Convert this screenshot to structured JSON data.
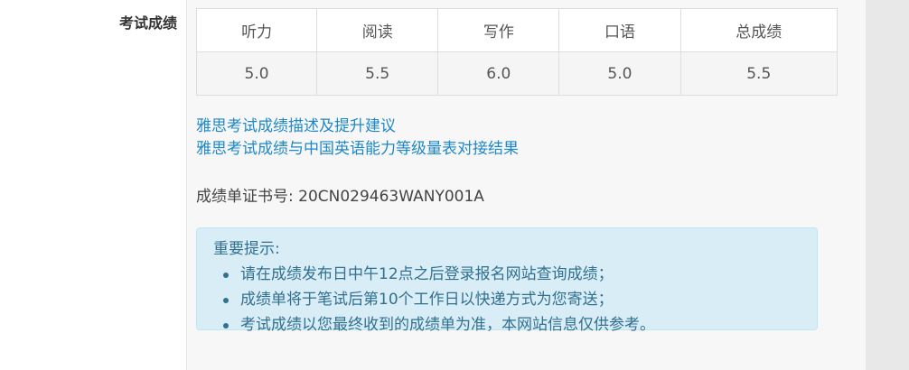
{
  "section": {
    "label": "考试成绩"
  },
  "scores": {
    "headers": [
      "听力",
      "阅读",
      "写作",
      "口语",
      "总成绩"
    ],
    "values": [
      "5.0",
      "5.5",
      "6.0",
      "5.0",
      "5.5"
    ]
  },
  "links": {
    "description": "雅思考试成绩描述及提升建议",
    "cefr": "雅思考试成绩与中国英语能力等级量表对接结果"
  },
  "certificate": {
    "text": "成绩单证书号: 20CN029463WANY001A"
  },
  "notice": {
    "title": "重要提示:",
    "items": [
      "请在成绩发布日中午12点之后登录报名网站查询成绩；",
      "成绩单将于笔试后第10个工作日以快递方式为您寄送；",
      "考试成绩以您最终收到的成绩单为准，本网站信息仅供参考。"
    ]
  },
  "colors": {
    "link": "#1e88c8",
    "notice_bg": "#d9edf7",
    "notice_text": "#31708f"
  }
}
